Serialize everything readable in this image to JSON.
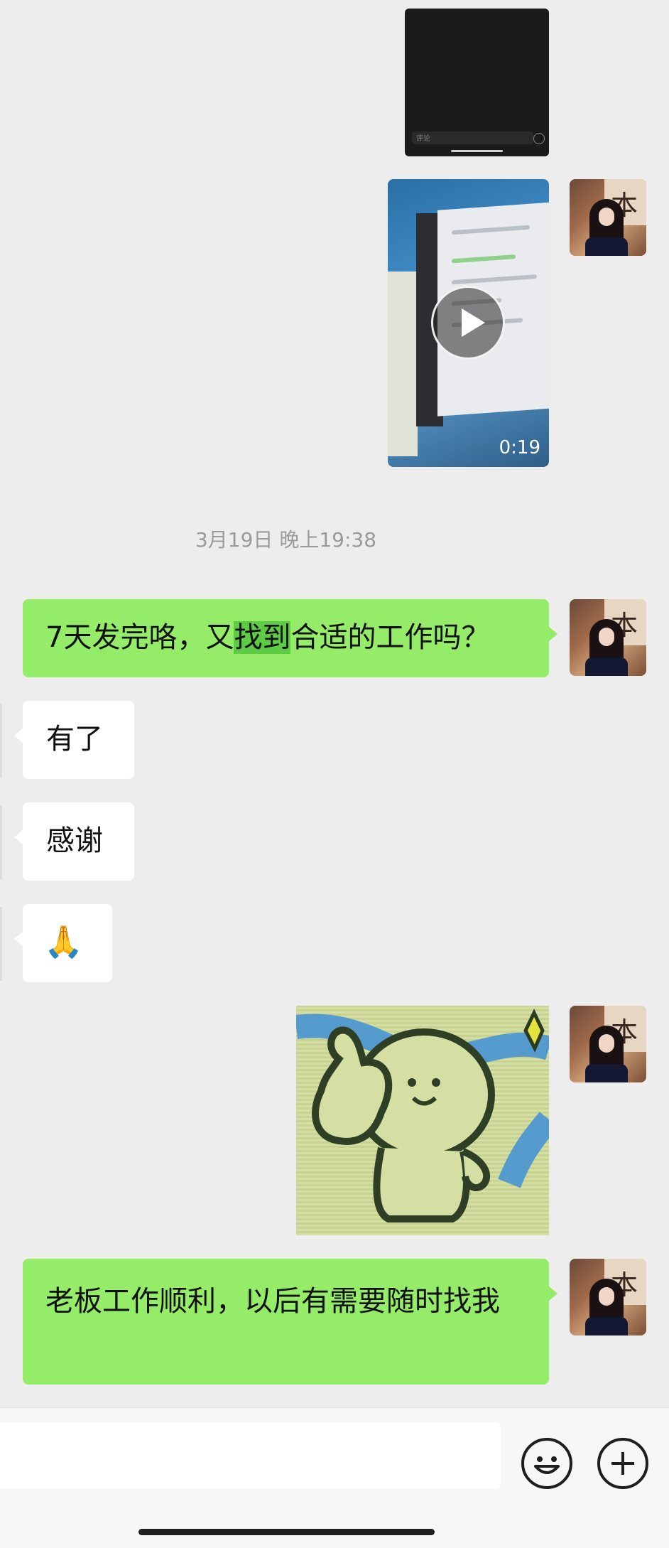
{
  "top_video": {
    "caption_placeholder": "评论"
  },
  "video_message": {
    "duration": "0:19"
  },
  "timestamp": "3月19日 晚上19:38",
  "messages": {
    "m1": {
      "before": "7天发完咯，又",
      "highlight": "找到",
      "after": "合适的工作吗？"
    },
    "m2": {
      "text": "有了"
    },
    "m3": {
      "text": "感谢"
    },
    "m4": {
      "emoji": "🙏"
    },
    "m6": {
      "text": "老板工作顺利，以后有需要随时找我"
    }
  },
  "avatar": {
    "glyph": "本"
  },
  "colors": {
    "sent_bubble": "#95EC69",
    "received_bubble": "#FFFFFF",
    "background": "#EDEDED",
    "highlight": "#5DCB43"
  },
  "input_bar": {
    "value": "",
    "icons": [
      "emoji-icon",
      "plus-icon"
    ]
  }
}
